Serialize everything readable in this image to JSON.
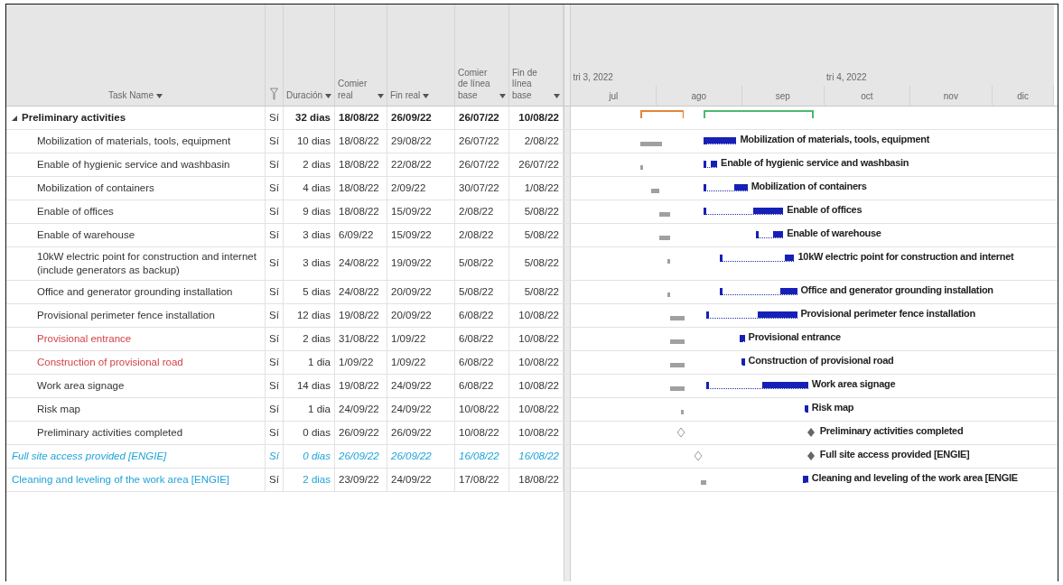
{
  "columns": [
    {
      "kind": "text",
      "label": "Task Name"
    },
    {
      "kind": "filter"
    },
    {
      "kind": "text",
      "label": "Duración"
    },
    {
      "kind": "text",
      "label": "Comier real"
    },
    {
      "kind": "text",
      "label": "Fin real"
    },
    {
      "kind": "text",
      "label": "Comier de línea base"
    },
    {
      "kind": "text",
      "label": "Fin de línea base"
    }
  ],
  "timescale": {
    "quarters": [
      "tri 3, 2022",
      "tri 4, 2022"
    ],
    "months": [
      "jul",
      "ago",
      "sep",
      "oct",
      "nov",
      "dic"
    ]
  },
  "tasks": [
    {
      "kind": "summary",
      "name": "Preliminary activities",
      "expanded": true,
      "flag": "Sí",
      "duration": "32 dias",
      "start": "18/08/22",
      "finish": "26/09/22",
      "bl_start": "26/07/22",
      "bl_finish": "10/08/22",
      "color": "#222222",
      "italic": false,
      "duration_colored": false,
      "children": [
        {
          "kind": "task",
          "name": "Mobilization of materials, tools, equipment",
          "flag": "Sí",
          "duration": "10 dias",
          "start": "18/08/22",
          "finish": "29/08/22",
          "bl_start": "26/07/22",
          "bl_finish": "2/08/22",
          "bar_label": "Mobilization of materials, tools, equipment",
          "color": "#333333",
          "italic": false,
          "duration_colored": false
        },
        {
          "kind": "task",
          "name": "Enable of hygienic service and washbasin",
          "flag": "Sí",
          "duration": "2 dias",
          "start": "18/08/22",
          "finish": "22/08/22",
          "bl_start": "26/07/22",
          "bl_finish": "26/07/22",
          "bar_label": "Enable of hygienic service and washbasin",
          "color": "#333333",
          "italic": false,
          "duration_colored": false
        },
        {
          "kind": "task",
          "name": "Mobilization of containers",
          "flag": "Sí",
          "duration": "4 dias",
          "start": "18/08/22",
          "finish": "2/09/22",
          "bl_start": "30/07/22",
          "bl_finish": "1/08/22",
          "bar_label": "Mobilization of containers",
          "color": "#333333",
          "italic": false,
          "duration_colored": false
        },
        {
          "kind": "task",
          "name": "Enable of offices",
          "flag": "Sí",
          "duration": "9 dias",
          "start": "18/08/22",
          "finish": "15/09/22",
          "bl_start": "2/08/22",
          "bl_finish": "5/08/22",
          "bar_label": "Enable of offices",
          "color": "#333333",
          "italic": false,
          "duration_colored": false
        },
        {
          "kind": "task",
          "name": "Enable of warehouse",
          "flag": "Sí",
          "duration": "3 dias",
          "start": "6/09/22",
          "finish": "15/09/22",
          "bl_start": "2/08/22",
          "bl_finish": "5/08/22",
          "bar_label": "Enable of warehouse",
          "color": "#333333",
          "italic": false,
          "duration_colored": false
        },
        {
          "kind": "task",
          "name": "10kW electric point for construction and internet (include generators as backup)",
          "flag": "Sí",
          "duration": "3 dias",
          "start": "24/08/22",
          "finish": "19/09/22",
          "bl_start": "5/08/22",
          "bl_finish": "5/08/22",
          "bar_label": "10kW electric point for construction and internet",
          "color": "#333333",
          "italic": false,
          "duration_colored": false
        },
        {
          "kind": "task",
          "name": "Office and generator grounding installation",
          "flag": "Sí",
          "duration": "5 dias",
          "start": "24/08/22",
          "finish": "20/09/22",
          "bl_start": "5/08/22",
          "bl_finish": "5/08/22",
          "bar_label": "Office and generator grounding installation",
          "color": "#333333",
          "italic": false,
          "duration_colored": false
        },
        {
          "kind": "task",
          "name": "Provisional perimeter fence installation",
          "flag": "Sí",
          "duration": "12 dias",
          "start": "19/08/22",
          "finish": "20/09/22",
          "bl_start": "6/08/22",
          "bl_finish": "10/08/22",
          "bar_label": "Provisional perimeter fence installation",
          "color": "#333333",
          "italic": false,
          "duration_colored": false
        },
        {
          "kind": "task",
          "name": "Provisional entrance",
          "flag": "Sí",
          "duration": "2 dias",
          "start": "31/08/22",
          "finish": "1/09/22",
          "bl_start": "6/08/22",
          "bl_finish": "10/08/22",
          "bar_label": "Provisional entrance",
          "color": "#d2424b",
          "italic": false,
          "duration_colored": false
        },
        {
          "kind": "task",
          "name": "Construction of provisional road",
          "flag": "Sí",
          "duration": "1 dia",
          "start": "1/09/22",
          "finish": "1/09/22",
          "bl_start": "6/08/22",
          "bl_finish": "10/08/22",
          "bar_label": "Construction of provisional road",
          "color": "#d2424b",
          "italic": false,
          "duration_colored": false
        },
        {
          "kind": "task",
          "name": "Work area signage",
          "flag": "Sí",
          "duration": "14 dias",
          "start": "19/08/22",
          "finish": "24/09/22",
          "bl_start": "6/08/22",
          "bl_finish": "10/08/22",
          "bar_label": "Work area signage",
          "color": "#333333",
          "italic": false,
          "duration_colored": false
        },
        {
          "kind": "task",
          "name": "Risk map",
          "flag": "Sí",
          "duration": "1 dia",
          "start": "24/09/22",
          "finish": "24/09/22",
          "bl_start": "10/08/22",
          "bl_finish": "10/08/22",
          "bar_label": "Risk map",
          "color": "#333333",
          "italic": false,
          "duration_colored": false
        },
        {
          "kind": "milestone",
          "name": "Preliminary activities completed",
          "flag": "Sí",
          "duration": "0 dias",
          "start": "26/09/22",
          "finish": "26/09/22",
          "bl_start": "10/08/22",
          "bl_finish": "10/08/22",
          "bar_label": "Preliminary activities completed",
          "color": "#333333",
          "italic": false,
          "duration_colored": false
        }
      ]
    },
    {
      "kind": "milestone",
      "name": "Full site access provided [ENGIE]",
      "flag": "Sí",
      "duration": "0 dias",
      "start": "26/09/22",
      "finish": "26/09/22",
      "bl_start": "16/08/22",
      "bl_finish": "16/08/22",
      "bar_label": "Full site access provided [ENGIE]",
      "color": "#1fa3d8",
      "italic": true,
      "duration_colored": true
    },
    {
      "kind": "task",
      "name": "Cleaning and leveling of the work area [ENGIE]",
      "flag": "Sí",
      "duration": "2 dias",
      "start": "23/09/22",
      "finish": "24/09/22",
      "bl_start": "17/08/22",
      "bl_finish": "18/08/22",
      "bar_label": "Cleaning and leveling of the work area [ENGIE",
      "color": "#1fa3d8",
      "italic": false,
      "duration_colored": true
    }
  ]
}
